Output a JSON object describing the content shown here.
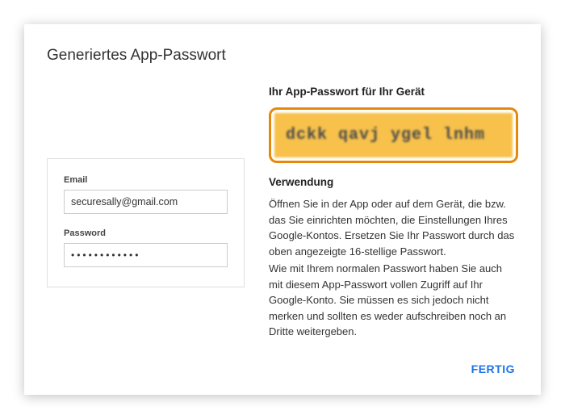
{
  "dialog": {
    "title": "Generiertes App-Passwort"
  },
  "form": {
    "email_label": "Email",
    "email_value": "securesally@gmail.com",
    "password_label": "Password",
    "password_value": "••••••••••••"
  },
  "right": {
    "heading": "Ihr App-Passwort für Ihr Gerät",
    "generated_password": "dckk qavj ygel lnhm",
    "usage_heading": "Verwendung",
    "usage_p1": "Öffnen Sie in der App oder auf dem Gerät, die bzw. das Sie einrichten möchten, die Einstellungen Ihres Google-Kontos. Ersetzen Sie Ihr Passwort durch das oben angezeigte 16-stellige Passwort.",
    "usage_p2": "Wie mit Ihrem normalen Passwort haben Sie auch mit diesem App-Passwort vollen Zugriff auf Ihr Google-Konto. Sie müssen es sich jedoch nicht merken und sollten es weder aufschreiben noch an Dritte weitergeben."
  },
  "footer": {
    "done_label": "FERTIG"
  }
}
